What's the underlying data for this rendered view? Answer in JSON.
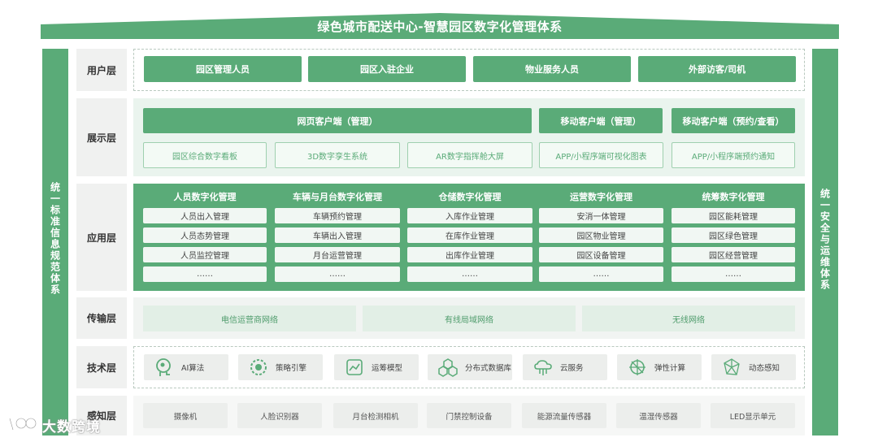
{
  "title": "绿色城市配送中心-智慧园区数字化管理体系",
  "side_left": "统一标准信息规范体系",
  "side_right": "统一安全与运维体系",
  "layers": {
    "user": {
      "label": "用户层",
      "items": [
        "园区管理人员",
        "园区入驻企业",
        "物业服务人员",
        "外部访客/司机"
      ]
    },
    "display": {
      "label": "展示层",
      "top": [
        "网页客户端（管理）",
        "移动客户端（管理）",
        "移动客户端（预约/查看）"
      ],
      "bottom": [
        "园区综合数字看板",
        "3D数字孪生系统",
        "AR数字指挥舱大屏",
        "APP/小程序端可视化图表",
        "APP/小程序端预约通知"
      ]
    },
    "application": {
      "label": "应用层",
      "columns": [
        {
          "title": "人员数字化管理",
          "items": [
            "人员出入管理",
            "人员态势管理",
            "人员监控管理",
            "……"
          ]
        },
        {
          "title": "车辆与月台数字化管理",
          "items": [
            "车辆预约管理",
            "车辆出入管理",
            "月台运营管理",
            "……"
          ]
        },
        {
          "title": "仓储数字化管理",
          "items": [
            "入库作业管理",
            "在库作业管理",
            "出库作业管理",
            "……"
          ]
        },
        {
          "title": "运营数字化管理",
          "items": [
            "安消一体管理",
            "园区物业管理",
            "园区设备管理",
            "……"
          ]
        },
        {
          "title": "统筹数字化管理",
          "items": [
            "园区能耗管理",
            "园区绿色管理",
            "园区经营管理",
            "……"
          ]
        }
      ]
    },
    "transport": {
      "label": "传输层",
      "items": [
        "电信运营商网络",
        "有线局域网络",
        "无线网络"
      ]
    },
    "tech": {
      "label": "技术层",
      "items": [
        {
          "label": "AI算法",
          "icon": "ai-head-icon"
        },
        {
          "label": "策略引擎",
          "icon": "strategy-engine-icon"
        },
        {
          "label": "运筹模型",
          "icon": "operations-model-icon"
        },
        {
          "label": "分布式数据库",
          "icon": "distributed-database-icon"
        },
        {
          "label": "云服务",
          "icon": "cloud-service-icon"
        },
        {
          "label": "弹性计算",
          "icon": "elastic-compute-icon"
        },
        {
          "label": "动态感知",
          "icon": "dynamic-sensing-icon"
        }
      ]
    },
    "sensing": {
      "label": "感知层",
      "items": [
        "摄像机",
        "人脸识别器",
        "月台检测相机",
        "门禁控制设备",
        "能源流量传感器",
        "温湿传感器",
        "LED显示单元"
      ]
    }
  },
  "watermark": "大数跨境",
  "colors": {
    "primary": "#5aab78",
    "soft": "#eaf4ee",
    "label_bg": "#f0f1f0"
  }
}
